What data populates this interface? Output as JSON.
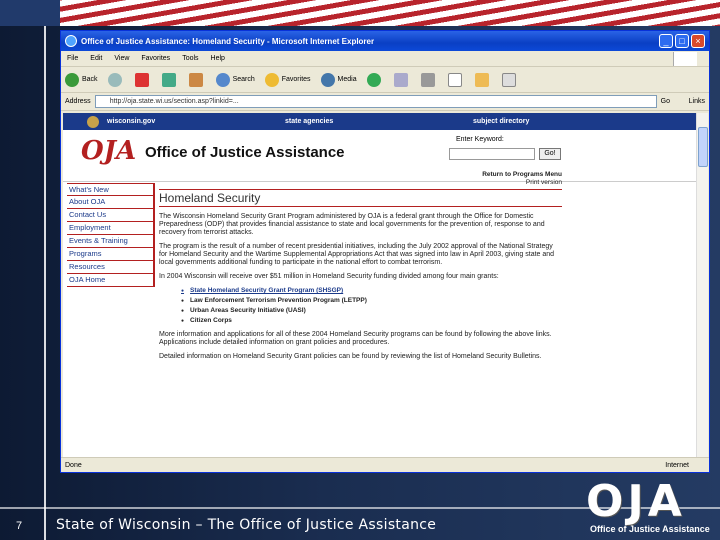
{
  "slide": {
    "number": "7",
    "footer_title": "State of Wisconsin – The Office of Justice Assistance",
    "logo_text": "OJA",
    "logo_subtext": "Office of Justice Assistance"
  },
  "browser": {
    "title": "Office of Justice Assistance:  Homeland Security - Microsoft Internet Explorer",
    "menu": [
      "File",
      "Edit",
      "View",
      "Favorites",
      "Tools",
      "Help"
    ],
    "toolbar": {
      "back": "Back",
      "search": "Search",
      "favorites": "Favorites",
      "media": "Media"
    },
    "address_label": "Address",
    "address_value": "http://oja.state.wi.us/section.asp?linkid=...",
    "go_label": "Go",
    "links_label": "Links",
    "status_text": "Done",
    "zone_text": "Internet"
  },
  "site": {
    "nav": [
      "wisconsin.gov",
      "state agencies",
      "subject directory"
    ],
    "oja_mark": "OJA",
    "office_name": "Office of Justice Assistance",
    "keyword_label": "Enter Keyword:",
    "keyword_go": "Go!",
    "leftnav": [
      "What's New",
      "About OJA",
      "Contact Us",
      "Employment",
      "Events & Training",
      "Programs",
      "Resources",
      "OJA Home"
    ],
    "return_link": "Return to Programs Menu",
    "print_version": "Print version",
    "page_title": "Homeland Security",
    "para1": "The Wisconsin Homeland Security Grant Program administered by OJA is a federal grant through the Office for Domestic Preparedness (ODP) that provides financial assistance to state and local governments for the prevention of, response to and recovery from terrorist attacks.",
    "para2": "The program is the result of a number of recent presidential initiatives, including the July 2002 approval of the National Strategy for Homeland Security and the Wartime Supplemental Appropriations Act that was signed into law in April 2003, giving state and local governments additional funding to participate in the national effort to combat terrorism.",
    "para3": "In 2004 Wisconsin will receive over $51 million in Homeland Security funding divided among four main grants:",
    "grants": [
      "State Homeland Security Grant Program (SHSGP)",
      "Law Enforcement Terrorism Prevention Program (LETPP)",
      "Urban Areas Security Initiative (UASI)",
      "Citizen Corps"
    ],
    "para4": "More information and applications for all of these 2004 Homeland Security programs can be found by following the above links. Applications include detailed information on grant policies and procedures.",
    "para5": "Detailed information on Homeland Security Grant policies can be found by reviewing the list of Homeland Security Bulletins."
  },
  "colors": {
    "accent_red": "#b32020",
    "nav_blue": "#1b3a8a",
    "xp_title": "#0a3fc4"
  }
}
